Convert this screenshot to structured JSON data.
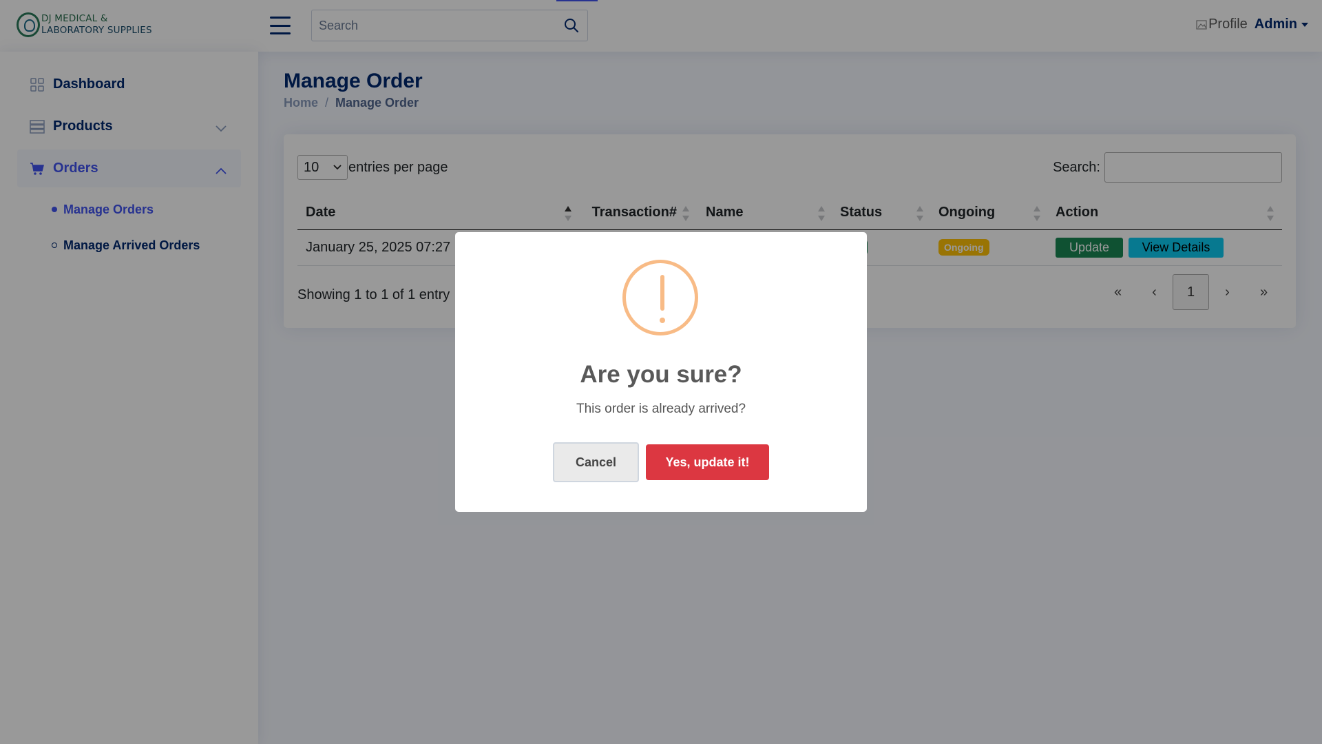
{
  "brand": {
    "line1": "DJ MEDICAL &",
    "line2": "LABORATORY SUPPLIES"
  },
  "header": {
    "search_placeholder": "Search",
    "profile_img_alt": "Profile",
    "username": "Admin"
  },
  "sidebar": {
    "items": [
      {
        "label": "Dashboard",
        "icon": "grid-icon"
      },
      {
        "label": "Products",
        "icon": "server-icon"
      },
      {
        "label": "Orders",
        "icon": "cart-icon"
      }
    ],
    "orders_submenu": [
      {
        "label": "Manage Orders"
      },
      {
        "label": "Manage Arrived Orders"
      }
    ]
  },
  "page": {
    "title": "Manage Order",
    "breadcrumb": {
      "home": "Home",
      "sep": "/",
      "current": "Manage Order"
    }
  },
  "datatable": {
    "per_page_value": "10",
    "per_page_label": "entries per page",
    "search_label": "Search:",
    "columns": [
      "Date",
      "Transaction#",
      "Name",
      "Status",
      "Ongoing",
      "Action"
    ],
    "rows": [
      {
        "date": "January 25, 2025 07:27",
        "ongoing": "Ongoing",
        "update_label": "Update",
        "details_label": "View Details"
      }
    ],
    "info": "Showing 1 to 1 of 1 entry",
    "pager": {
      "first": "«",
      "prev": "‹",
      "current": "1",
      "next": "›",
      "last": "»"
    }
  },
  "modal": {
    "title": "Are you sure?",
    "text": "This order is already arrived?",
    "cancel_label": "Cancel",
    "confirm_label": "Yes, update it!",
    "icon": "warning-icon"
  },
  "colors": {
    "primary": "#012970",
    "accent": "#4154f1",
    "warning_icon": "#f8bb86",
    "confirm": "#dc3741",
    "badge_ongoing": "#ffc107",
    "btn_update": "#198754",
    "btn_details": "#0dcaf0"
  }
}
